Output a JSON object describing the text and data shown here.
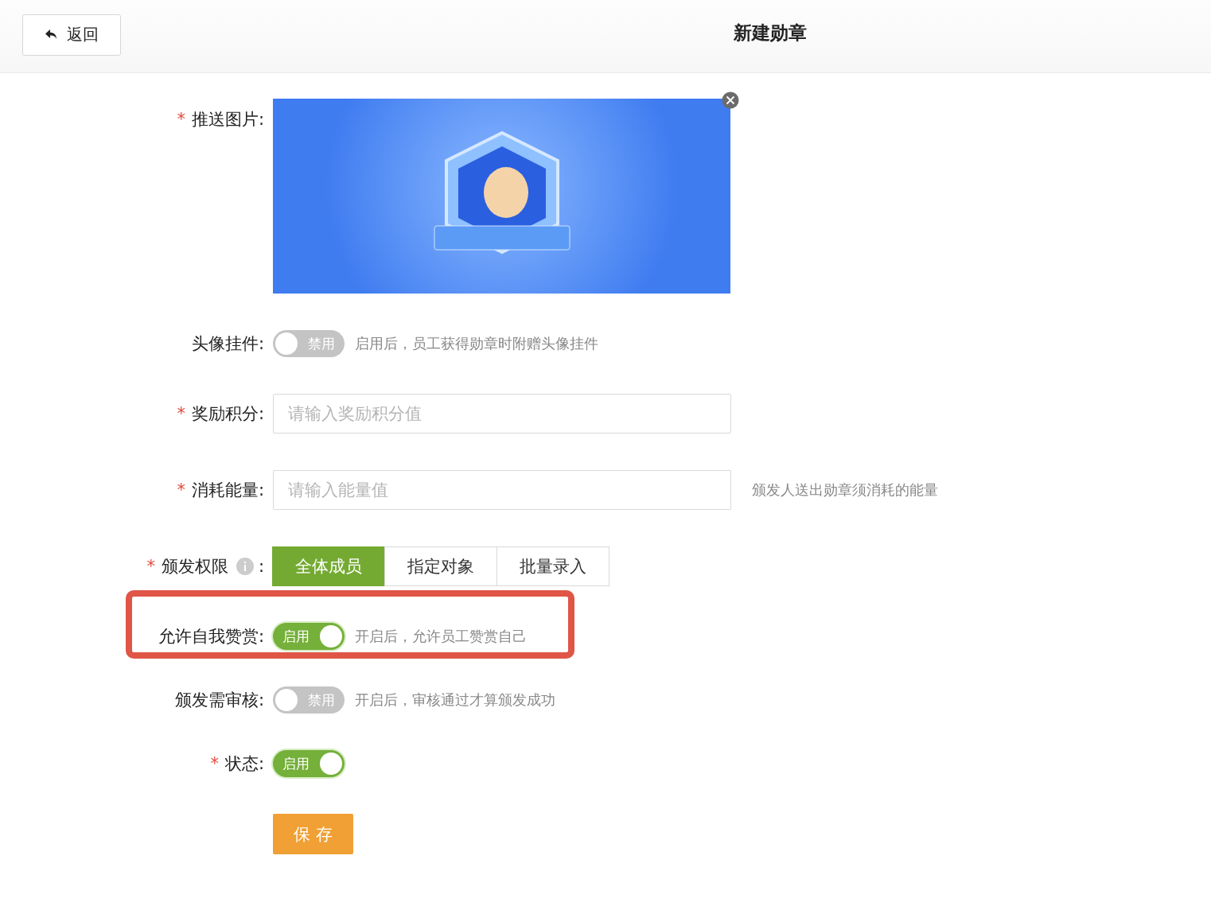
{
  "header": {
    "back_button": "返回",
    "title": "新建勋章"
  },
  "form": [
    {
      "kind": "image",
      "required_mark": "*",
      "label": "推送图片:"
    },
    {
      "kind": "switch",
      "label": "头像挂件:",
      "on": false,
      "switch_label": "禁用",
      "hint": "启用后，员工获得勋章时附赠头像挂件"
    },
    {
      "kind": "input",
      "required_mark": "*",
      "label": "奖励积分:",
      "placeholder": "请输入奖励积分值"
    },
    {
      "kind": "input",
      "required_mark": "*",
      "label": "消耗能量:",
      "placeholder": "请输入能量值",
      "hint": "颁发人送出勋章须消耗的能量"
    },
    {
      "kind": "segmented",
      "required_mark": "*",
      "label": "颁发权限",
      "info_icon": true,
      "label_suffix": ":",
      "options": [
        {
          "label": "全体成员",
          "selected": true
        },
        {
          "label": "指定对象",
          "selected": false
        },
        {
          "label": "批量录入",
          "selected": false
        }
      ]
    },
    {
      "kind": "switch",
      "label": "允许自我赞赏:",
      "on": true,
      "switch_label": "启用",
      "hint": "开启后，允许员工赞赏自己",
      "highlighted": true
    },
    {
      "kind": "switch",
      "label": "颁发需审核:",
      "on": false,
      "switch_label": "禁用",
      "hint": "开启后，审核通过才算颁发成功"
    },
    {
      "kind": "switch",
      "required_mark": "*",
      "label": "状态:",
      "on": true,
      "switch_label": "启用"
    }
  ],
  "save_button": "保 存"
}
